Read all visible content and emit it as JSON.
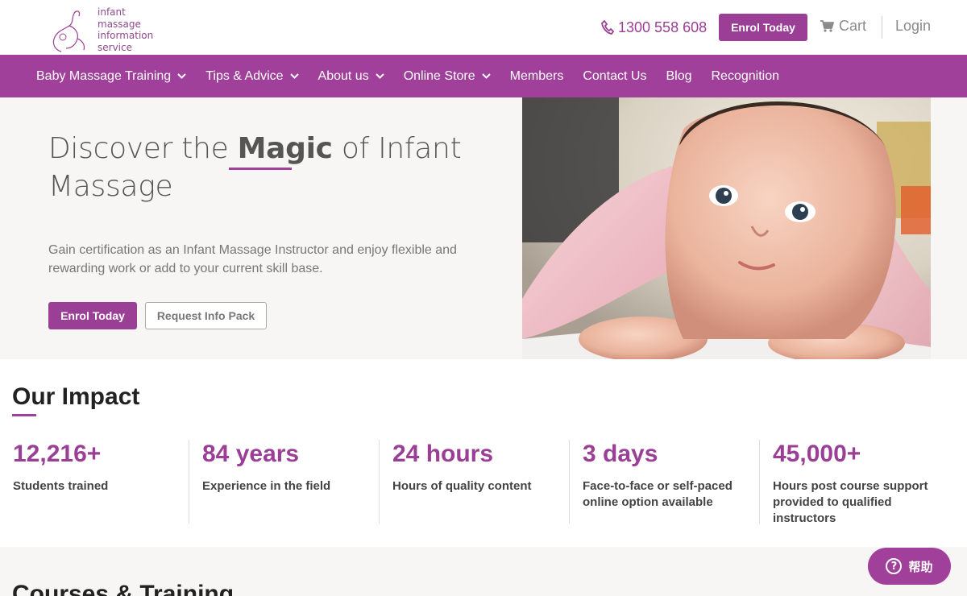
{
  "header": {
    "logo_lines": [
      "infant",
      "massage",
      "information",
      "service"
    ],
    "phone": "1300 558 608",
    "enrol_label": "Enrol Today",
    "cart_label": "Cart",
    "login_label": "Login"
  },
  "nav": {
    "items": [
      {
        "label": "Baby Massage Training",
        "dropdown": true
      },
      {
        "label": "Tips & Advice",
        "dropdown": true
      },
      {
        "label": "About us",
        "dropdown": true
      },
      {
        "label": "Online Store",
        "dropdown": true
      },
      {
        "label": "Members",
        "dropdown": false
      },
      {
        "label": "Contact Us",
        "dropdown": false
      },
      {
        "label": "Blog",
        "dropdown": false
      },
      {
        "label": "Recognition",
        "dropdown": false
      }
    ]
  },
  "hero": {
    "title_pre": "Discover the ",
    "title_emph": "Magic",
    "title_post": " of Infant Massage",
    "subtitle": "Gain certification as an Infant Massage Instructor and enjoy flexible and rewarding work or add to your current skill base.",
    "enrol_label": "Enrol Today",
    "info_label": "Request Info Pack"
  },
  "impact": {
    "title": "Our Impact",
    "stats": [
      {
        "value": "12,216+",
        "label": "Students trained"
      },
      {
        "value": "84 years",
        "label": "Experience in the field"
      },
      {
        "value": "24 hours",
        "label": "Hours of quality content"
      },
      {
        "value": "3 days",
        "label": "Face-to-face or self-paced online option available"
      },
      {
        "value": "45,000+",
        "label": "Hours post course support provided to qualified instructors"
      }
    ]
  },
  "courses": {
    "title": "Courses & Training"
  },
  "help": {
    "label": "帮助"
  },
  "colors": {
    "brand": "#a0409b",
    "hero_bg": "#f7f6f4"
  }
}
